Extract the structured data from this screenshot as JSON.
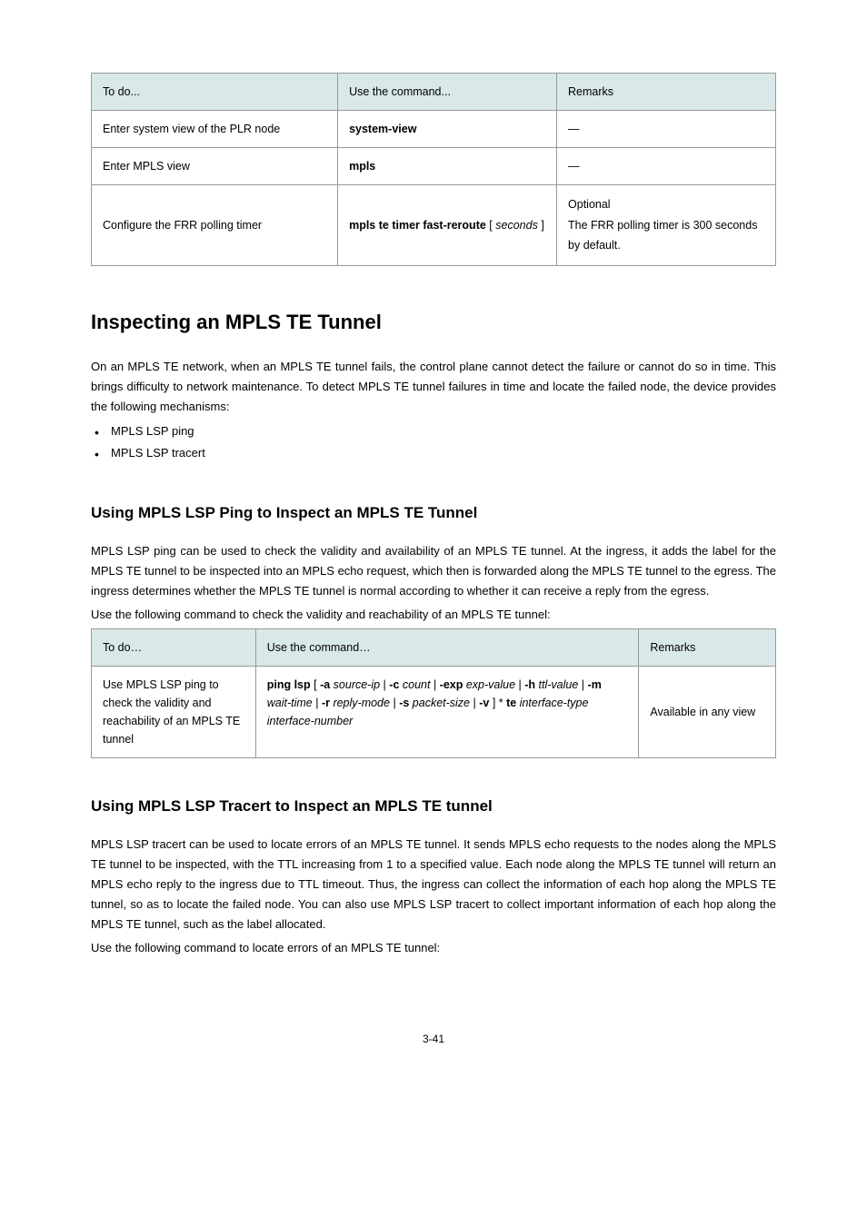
{
  "table1": {
    "headers": [
      "To do...",
      "Use the command...",
      "Remarks"
    ],
    "rows": [
      {
        "task": "Enter system view of the PLR node",
        "cmd": "system-view",
        "remarks": "—"
      },
      {
        "task": "Enter MPLS view",
        "cmd": "mpls",
        "remarks": "—"
      },
      {
        "task": "Configure the FRR polling timer",
        "cmd_prefix": "mpls te timer fast-reroute",
        "cmd_bracket_open": "[",
        "cmd_arg": "seconds",
        "cmd_bracket_close": "]",
        "remarks_l1": "Optional",
        "remarks_l2": "The FRR polling timer is 300 seconds by default."
      }
    ]
  },
  "section1": {
    "heading": "Inspecting an MPLS TE Tunnel",
    "para": "On an MPLS TE network, when an MPLS TE tunnel fails, the control plane cannot detect the failure or cannot do so in time. This brings difficulty to network maintenance. To detect MPLS TE tunnel failures in time and locate the failed node, the device provides the following mechanisms:",
    "bullets": [
      "MPLS LSP ping",
      "MPLS LSP tracert"
    ]
  },
  "section2": {
    "heading": "Using MPLS LSP Ping to Inspect an MPLS TE Tunnel",
    "para1": "MPLS LSP ping can be used to check the validity and availability of an MPLS TE tunnel. At the ingress, it adds the label for the MPLS TE tunnel to be inspected into an MPLS echo request, which then is forwarded along the MPLS TE tunnel to the egress. The ingress determines whether the MPLS TE tunnel is normal according to whether it can receive a reply from the egress.",
    "para2": "Use the following command to check the validity and reachability of an MPLS TE tunnel:"
  },
  "table2": {
    "headers": [
      "To do…",
      "Use the command…",
      "Remarks"
    ],
    "row": {
      "task": "Use MPLS LSP ping to check the validity and reachability of an MPLS TE tunnel",
      "cmd_parts": {
        "p1": "ping lsp",
        "o1": " [ ",
        "p2": "-a",
        "a1": " source-ip ",
        "s1": "| ",
        "p3": "-c",
        "a2": " count ",
        "s2": "| ",
        "p4": "-exp",
        "a3": " exp-value ",
        "s3": "| ",
        "p5": "-h",
        "a4": " ttl-value ",
        "s4": "| ",
        "p6": "-m",
        "a5": " wait-time ",
        "s5": "| ",
        "p7": "-r",
        "a6": " reply-mode ",
        "s6": "| ",
        "p8": "-s",
        "a7": " packet-size ",
        "s7": "| ",
        "p9": "-v",
        "o2": " ] *",
        "p10": " te",
        "a8": " interface-type interface-number"
      },
      "remarks": "Available in any view"
    }
  },
  "section3": {
    "heading": "Using MPLS LSP Tracert to Inspect an MPLS TE tunnel",
    "para1": "MPLS LSP tracert can be used to locate errors of an MPLS TE tunnel. It sends MPLS echo requests to the nodes along the MPLS TE tunnel to be inspected, with the TTL increasing from 1 to a specified value. Each node along the MPLS TE tunnel will return an MPLS echo reply to the ingress due to TTL timeout. Thus, the ingress can collect the information of each hop along the MPLS TE tunnel, so as to locate the failed node. You can also use MPLS LSP tracert to collect important information of each hop along the MPLS TE tunnel, such as the label allocated.",
    "para2": "Use the following command to locate errors of an MPLS TE tunnel:"
  },
  "page_number": "3-41"
}
